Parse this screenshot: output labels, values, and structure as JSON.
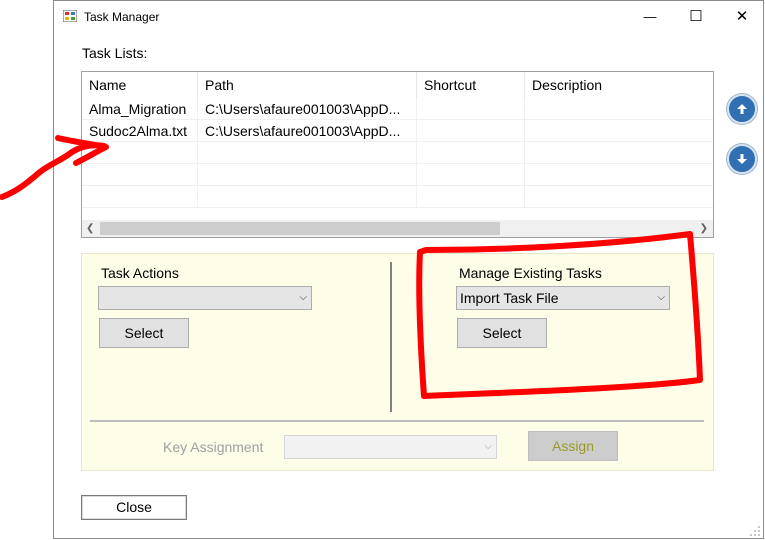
{
  "window": {
    "title": "Task Manager",
    "controls": {
      "minimize": "—",
      "maximize": "☐",
      "close": "✕"
    }
  },
  "task_lists": {
    "label": "Task Lists:",
    "columns": [
      "Name",
      "Path",
      "Shortcut",
      "Description"
    ],
    "rows": [
      {
        "name": "Alma_Migration",
        "path": "C:\\Users\\afaure001003\\AppD...",
        "shortcut": "",
        "description": ""
      },
      {
        "name": "Sudoc2Alma.txt",
        "path": "C:\\Users\\afaure001003\\AppD...",
        "shortcut": "",
        "description": ""
      }
    ]
  },
  "task_actions": {
    "label": "Task Actions",
    "selected": "",
    "select_label": "Select"
  },
  "manage_tasks": {
    "label": "Manage Existing Tasks",
    "selected": "Import Task File",
    "select_label": "Select"
  },
  "key_assignment": {
    "label": "Key Assignment",
    "selected": "",
    "assign_label": "Assign"
  },
  "close_label": "Close",
  "colors": {
    "panel_bg": "#fdfde8",
    "annotation": "#ff0000",
    "nav_button": "#2f6fb2"
  }
}
